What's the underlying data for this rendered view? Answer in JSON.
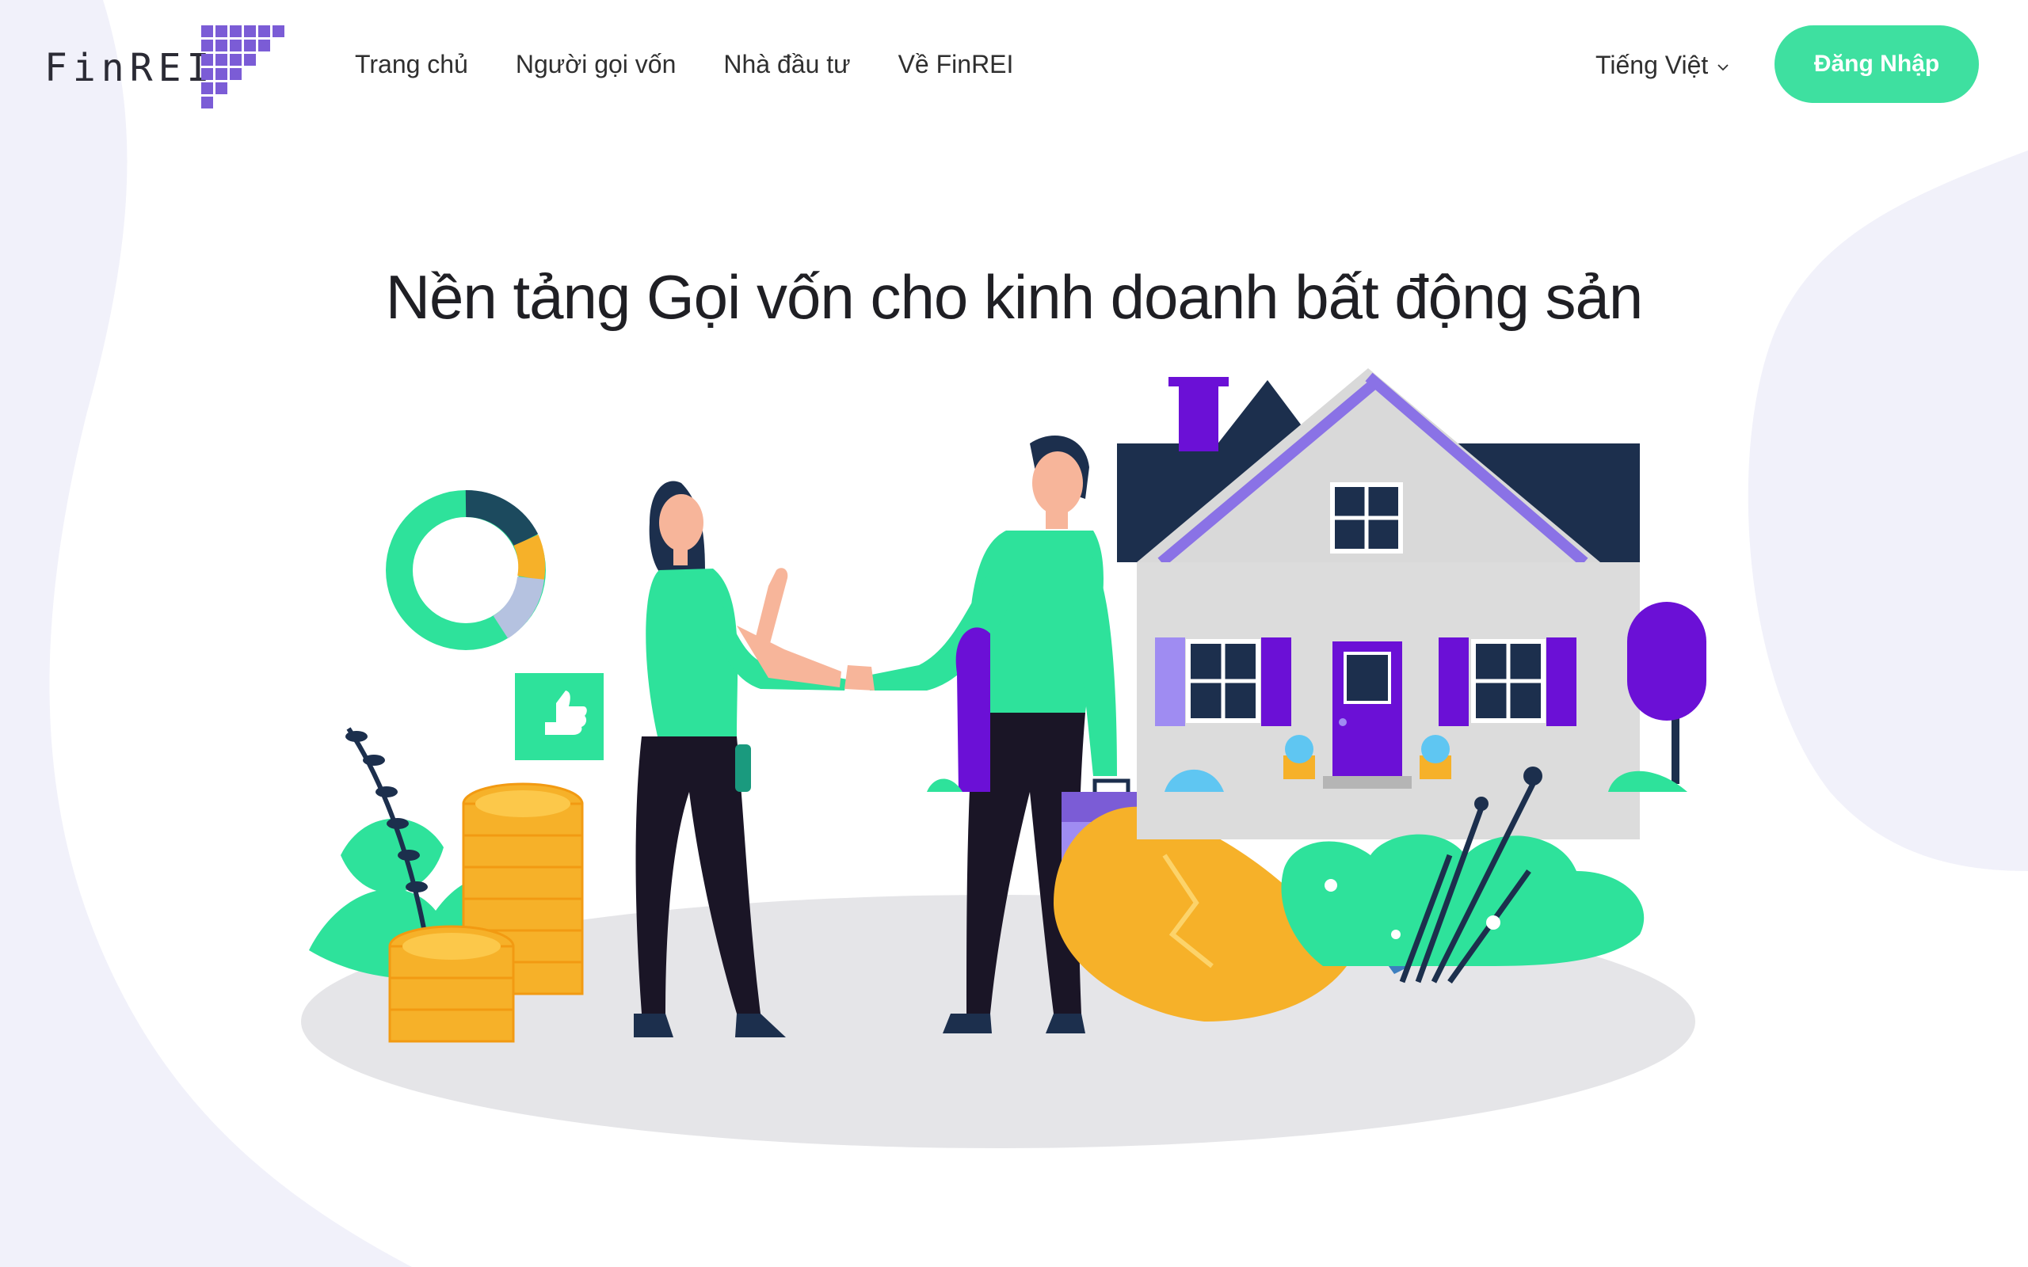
{
  "brand": {
    "name": "FinREI"
  },
  "nav": {
    "items": [
      {
        "label": "Trang chủ"
      },
      {
        "label": "Người gọi vốn"
      },
      {
        "label": "Nhà đầu tư"
      },
      {
        "label": "Về FinREI"
      }
    ]
  },
  "language": {
    "selected": "Tiếng Việt",
    "icon": "chevron-down-icon"
  },
  "auth": {
    "login_label": "Đăng Nhập"
  },
  "hero": {
    "title": "Nền tảng Gọi vốn cho kinh doanh bất động sản"
  },
  "colors": {
    "accent": "#3ee0a0",
    "brand_purple": "#7b5cd6",
    "dark_navy": "#1c2f4d",
    "gold": "#f6b129",
    "background_blob": "#f1f1fa"
  }
}
